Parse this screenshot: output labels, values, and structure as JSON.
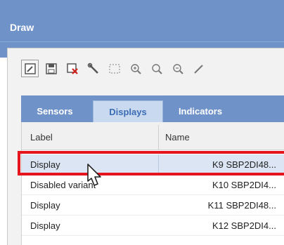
{
  "window": {
    "title": "Draw"
  },
  "toolbar": {
    "icons": [
      "edit-icon",
      "save-icon",
      "delete-icon",
      "wrench-icon",
      "select-rect-icon",
      "zoom-in-icon",
      "zoom-icon",
      "zoom-out-icon",
      "pen-icon"
    ]
  },
  "tabs": [
    {
      "label": "Sensors",
      "active": false
    },
    {
      "label": "Displays",
      "active": true
    },
    {
      "label": "Indicators",
      "active": false
    }
  ],
  "grid": {
    "columns": [
      "Label",
      "Name"
    ],
    "rows": [
      {
        "label": "Display",
        "name": "K9 SBP2DI48...",
        "selected": true
      },
      {
        "label": "Disabled variant",
        "name": "K10 SBP2DI4...",
        "selected": false
      },
      {
        "label": "Display",
        "name": "K11 SBP2DI48...",
        "selected": false
      },
      {
        "label": "Display",
        "name": "K12 SBP2DI4...",
        "selected": false
      }
    ]
  },
  "colors": {
    "header": "#6f92c9",
    "highlight": "#e6141c",
    "selected_row": "#dbe5f3",
    "active_tab": "#c8d9f0"
  }
}
